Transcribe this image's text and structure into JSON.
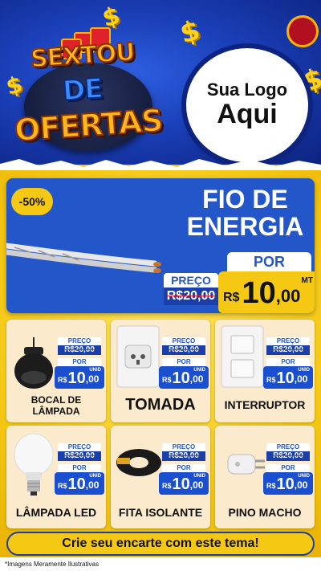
{
  "header": {
    "title_line1": "SEXTOU",
    "title_line2": "DE",
    "title_line3": "OFERTAS",
    "logo_line1": "Sua Logo",
    "logo_line2": "Aqui",
    "dollar_sign": "$"
  },
  "hero": {
    "discount": "-50%",
    "title_line1": "FIO DE",
    "title_line2": "ENERGIA",
    "por_label": "POR",
    "preco_label": "PREÇO",
    "old_price": "R$20,00",
    "currency": "R$",
    "price_int": "10",
    "price_cents": ",00",
    "unit": "MT"
  },
  "products": [
    {
      "name": "BOCAL DE LÂMPADA",
      "preco_label": "PREÇO",
      "old_price": "R$20,00",
      "por_label": "POR",
      "currency": "R$",
      "price_int": "10",
      "price_cents": ",00",
      "unit": "UNID",
      "icon": "lamp-socket-icon"
    },
    {
      "name": "TOMADA",
      "preco_label": "PREÇO",
      "old_price": "R$20,00",
      "por_label": "POR",
      "currency": "R$",
      "price_int": "10",
      "price_cents": ",00",
      "unit": "UNID",
      "icon": "outlet-icon"
    },
    {
      "name": "INTERRUPTOR",
      "preco_label": "PREÇO",
      "old_price": "R$20,00",
      "por_label": "POR",
      "currency": "R$",
      "price_int": "10",
      "price_cents": ",00",
      "unit": "UNID",
      "icon": "switch-icon"
    },
    {
      "name": "LÂMPADA LED",
      "preco_label": "PREÇO",
      "old_price": "R$20,00",
      "por_label": "POR",
      "currency": "R$",
      "price_int": "10",
      "price_cents": ",00",
      "unit": "UNID",
      "icon": "led-bulb-icon"
    },
    {
      "name": "FITA ISOLANTE",
      "preco_label": "PREÇO",
      "old_price": "R$20,00",
      "por_label": "POR",
      "currency": "R$",
      "price_int": "10",
      "price_cents": ",00",
      "unit": "UNID",
      "icon": "tape-icon"
    },
    {
      "name": "PINO MACHO",
      "preco_label": "PREÇO",
      "old_price": "R$20,00",
      "por_label": "POR",
      "currency": "R$",
      "price_int": "10",
      "price_cents": ",00",
      "unit": "UNID",
      "icon": "plug-icon"
    }
  ],
  "cta": "Crie seu encarte com este tema!",
  "footnote": "*Imagens Meramente Ilustrativas",
  "colors": {
    "blue": "#2356c9",
    "yellow": "#f5c814",
    "red": "#e0202a"
  }
}
